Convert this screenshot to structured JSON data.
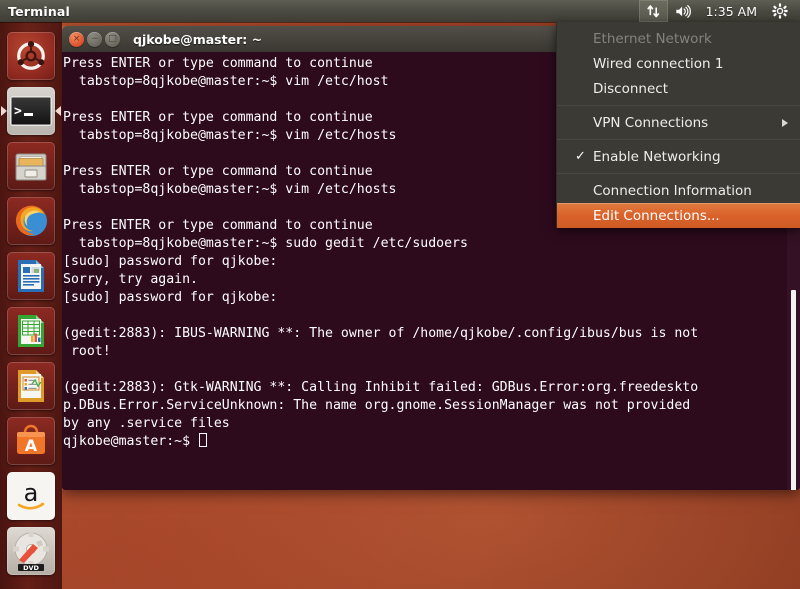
{
  "panel": {
    "app_title": "Terminal",
    "clock": "1:35 AM",
    "icons": {
      "network": "network-updown-icon",
      "volume": "volume-icon",
      "gear": "gear-icon"
    }
  },
  "launcher": {
    "items": [
      {
        "name": "ubuntu-dash",
        "label": "Ubuntu Dash"
      },
      {
        "name": "terminal",
        "label": "Terminal",
        "running": true
      },
      {
        "name": "files",
        "label": "Files"
      },
      {
        "name": "firefox",
        "label": "Firefox Web Browser"
      },
      {
        "name": "libreoffice-writer",
        "label": "LibreOffice Writer"
      },
      {
        "name": "libreoffice-calc",
        "label": "LibreOffice Calc"
      },
      {
        "name": "libreoffice-impress",
        "label": "LibreOffice Impress"
      },
      {
        "name": "ubuntu-software-center",
        "label": "Ubuntu Software Center"
      },
      {
        "name": "amazon",
        "label": "Amazon"
      },
      {
        "name": "system-settings",
        "label": "System Settings"
      }
    ]
  },
  "terminal": {
    "title": "qjkobe@master: ~",
    "window_buttons": {
      "close": "×",
      "minimize": "−",
      "maximize": "□"
    },
    "content": "Press ENTER or type command to continue\n  tabstop=8qjkobe@master:~$ vim /etc/host\n\nPress ENTER or type command to continue\n  tabstop=8qjkobe@master:~$ vim /etc/hosts\n\nPress ENTER or type command to continue\n  tabstop=8qjkobe@master:~$ vim /etc/hosts\n\nPress ENTER or type command to continue\n  tabstop=8qjkobe@master:~$ sudo gedit /etc/sudoers\n[sudo] password for qjkobe:\nSorry, try again.\n[sudo] password for qjkobe:\n\n(gedit:2883): IBUS-WARNING **: The owner of /home/qjkobe/.config/ibus/bus is not\n root!\n\n(gedit:2883): Gtk-WARNING **: Calling Inhibit failed: GDBus.Error:org.freedeskto\np.DBus.Error.ServiceUnknown: The name org.gnome.SessionManager was not provided\nby any .service files\n",
    "prompt": "qjkobe@master:~$ "
  },
  "network_menu": {
    "items": [
      {
        "label": "Ethernet Network",
        "state": "disabled"
      },
      {
        "label": "Wired connection 1",
        "state": "normal"
      },
      {
        "label": "Disconnect",
        "state": "normal"
      },
      {
        "label": "VPN Connections",
        "state": "submenu"
      },
      {
        "label": "Enable Networking",
        "state": "checked"
      },
      {
        "label": "Connection Information",
        "state": "normal"
      },
      {
        "label": "Edit Connections...",
        "state": "highlight"
      }
    ]
  },
  "colors": {
    "panel_bg": "#4d4c43",
    "menu_bg": "#3b3a34",
    "highlight": "#d9622a",
    "terminal_bg": "#2e0a1d",
    "terminal_fg": "#ffffff",
    "desktop": "#ad4a2b"
  }
}
